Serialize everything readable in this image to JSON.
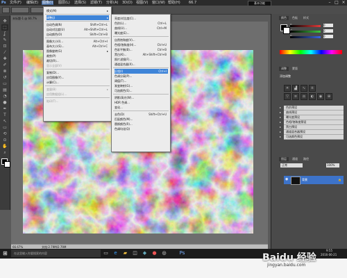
{
  "menubar": {
    "items": [
      "文件(F)",
      "编辑(E)",
      "图像(I)",
      "图层(L)",
      "选择(S)",
      "滤镜(T)",
      "分析(A)",
      "3D(D)",
      "视图(V)",
      "窗口(W)",
      "帮助(H)"
    ],
    "zoom": "66.7",
    "workspace": "基本功能"
  },
  "tools": [
    "move-tool",
    "marquee-tool",
    "lasso-tool",
    "quick-select-tool",
    "crop-tool",
    "eyedropper-tool",
    "healing-tool",
    "brush-tool",
    "clone-tool",
    "history-brush-tool",
    "eraser-tool",
    "gradient-tool",
    "blur-tool",
    "dodge-tool",
    "pen-tool",
    "type-tool",
    "path-select-tool",
    "shape-tool",
    "3d-rotate-tool",
    "3d-camera-tool",
    "hand-tool",
    "zoom-tool"
  ],
  "document": {
    "tab": "未标题-1 @ 66.7%",
    "zoom_status": "66.67%",
    "doc_info": "文档:2.79M/2.79M"
  },
  "image_menu": {
    "items": [
      {
        "label": "模式(M)",
        "shortcut": "",
        "submenu": true
      },
      {
        "sep": true
      },
      {
        "label": "调整(J)",
        "shortcut": "",
        "submenu": true,
        "highlight": true
      },
      {
        "sep": true
      },
      {
        "label": "自动色调(N)",
        "shortcut": "Shift+Ctrl+L"
      },
      {
        "label": "自动对比度(U)",
        "shortcut": "Alt+Shift+Ctrl+L"
      },
      {
        "label": "自动颜色(O)",
        "shortcut": "Shift+Ctrl+B"
      },
      {
        "sep": true
      },
      {
        "label": "图像大小(I)...",
        "shortcut": "Alt+Ctrl+I"
      },
      {
        "label": "画布大小(S)...",
        "shortcut": "Alt+Ctrl+C"
      },
      {
        "label": "图像旋转(G)",
        "shortcut": "",
        "submenu": true
      },
      {
        "label": "裁剪(P)",
        "shortcut": ""
      },
      {
        "label": "裁切(R)...",
        "shortcut": ""
      },
      {
        "label": "显示全部(V)",
        "shortcut": "",
        "disabled": true
      },
      {
        "sep": true
      },
      {
        "label": "复制(D)...",
        "shortcut": ""
      },
      {
        "label": "应用图像(Y)...",
        "shortcut": ""
      },
      {
        "label": "计算(C)...",
        "shortcut": ""
      },
      {
        "sep": true
      },
      {
        "label": "变量(B)",
        "shortcut": "",
        "submenu": true,
        "disabled": true
      },
      {
        "label": "应用数据组(L)...",
        "shortcut": "",
        "disabled": true
      },
      {
        "sep": true
      },
      {
        "label": "陷印(T)...",
        "shortcut": "",
        "disabled": true
      }
    ]
  },
  "adjust_menu": {
    "items": [
      {
        "label": "亮度/对比度(C)...",
        "shortcut": ""
      },
      {
        "label": "色阶(L)...",
        "shortcut": "Ctrl+L"
      },
      {
        "label": "曲线(U)...",
        "shortcut": "Ctrl+M"
      },
      {
        "label": "曝光度(E)...",
        "shortcut": ""
      },
      {
        "sep": true
      },
      {
        "label": "自然饱和度(V)...",
        "shortcut": ""
      },
      {
        "label": "色相/饱和度(H)...",
        "shortcut": "Ctrl+U"
      },
      {
        "label": "色彩平衡(B)...",
        "shortcut": "Ctrl+B"
      },
      {
        "label": "黑白(K)...",
        "shortcut": "Alt+Shift+Ctrl+B"
      },
      {
        "label": "照片滤镜(F)...",
        "shortcut": ""
      },
      {
        "label": "通道混合器(X)...",
        "shortcut": ""
      },
      {
        "sep": true
      },
      {
        "label": "反相(I)",
        "shortcut": "Ctrl+I",
        "highlight": true
      },
      {
        "label": "色调分离(P)...",
        "shortcut": ""
      },
      {
        "label": "阈值(T)...",
        "shortcut": ""
      },
      {
        "label": "渐变映射(G)...",
        "shortcut": ""
      },
      {
        "label": "可选颜色(S)...",
        "shortcut": ""
      },
      {
        "sep": true
      },
      {
        "label": "阴影/高光(W)...",
        "shortcut": ""
      },
      {
        "label": "HDR 色调...",
        "shortcut": ""
      },
      {
        "label": "变化...",
        "shortcut": ""
      },
      {
        "sep": true
      },
      {
        "label": "去色(D)",
        "shortcut": "Shift+Ctrl+U"
      },
      {
        "label": "匹配颜色(M)...",
        "shortcut": ""
      },
      {
        "label": "替换颜色(R)...",
        "shortcut": ""
      },
      {
        "label": "色调均化(Q)",
        "shortcut": ""
      }
    ]
  },
  "color_panel": {
    "tabs": [
      "颜色",
      "色板",
      "样式"
    ],
    "sliders": [
      {
        "label": "R",
        "value": "0",
        "color": "#e23a3a"
      },
      {
        "label": "G",
        "value": "0",
        "color": "#3ec93e"
      },
      {
        "label": "B",
        "value": "0",
        "color": "#3a66e2"
      }
    ]
  },
  "adjust_panel": {
    "tabs": [
      "调整",
      "蒙版"
    ],
    "title": "添加调整",
    "presets": [
      "色阶预设",
      "曲线预设",
      "曝光度预设",
      "色相/饱和度预设",
      "黑白预设",
      "通道混合器预设",
      "可选颜色预设"
    ]
  },
  "layers_panel": {
    "tabs": [
      "图层",
      "通道",
      "路径"
    ],
    "blend_mode": "正常",
    "opacity": "100%",
    "layer_name": "背景"
  },
  "taskbar": {
    "search": "在这里输入你要搜索的内容",
    "time": "9:55",
    "date": "2016-06-21"
  },
  "watermark": "Baidu 经验",
  "watermark_url": "jingyan.baidu.com"
}
